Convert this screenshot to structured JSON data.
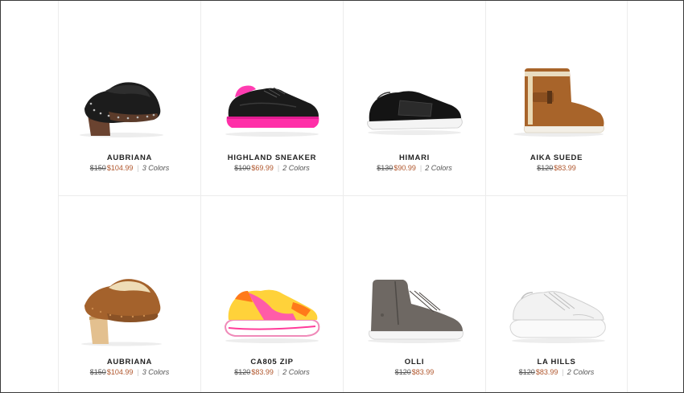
{
  "products": [
    {
      "name": "AUBRIANA",
      "original_price": "$150",
      "sale_price": "$104.99",
      "colors": "3 Colors",
      "icon": "black-clog-icon"
    },
    {
      "name": "HIGHLAND SNEAKER",
      "original_price": "$100",
      "sale_price": "$69.99",
      "colors": "2 Colors",
      "icon": "pink-platform-sneaker-icon"
    },
    {
      "name": "HIMARI",
      "original_price": "$130",
      "sale_price": "$90.99",
      "colors": "2 Colors",
      "icon": "black-slip-on-sneaker-icon"
    },
    {
      "name": "AIKA SUEDE",
      "original_price": "$120",
      "sale_price": "$83.99",
      "colors": "",
      "icon": "chestnut-boot-icon"
    },
    {
      "name": "AUBRIANA",
      "original_price": "$150",
      "sale_price": "$104.99",
      "colors": "3 Colors",
      "icon": "chestnut-clog-icon"
    },
    {
      "name": "CA805 ZIP",
      "original_price": "$120",
      "sale_price": "$83.99",
      "colors": "2 Colors",
      "icon": "neon-runner-sneaker-icon"
    },
    {
      "name": "OLLI",
      "original_price": "$120",
      "sale_price": "$83.99",
      "colors": "",
      "icon": "grey-high-top-icon"
    },
    {
      "name": "LA HILLS",
      "original_price": "$120",
      "sale_price": "$83.99",
      "colors": "2 Colors",
      "icon": "white-sneaker-icon"
    }
  ],
  "colors": {
    "sale_price": "#b0562c",
    "grid_border": "#ececec",
    "frame_border": "#3a3a3a"
  }
}
